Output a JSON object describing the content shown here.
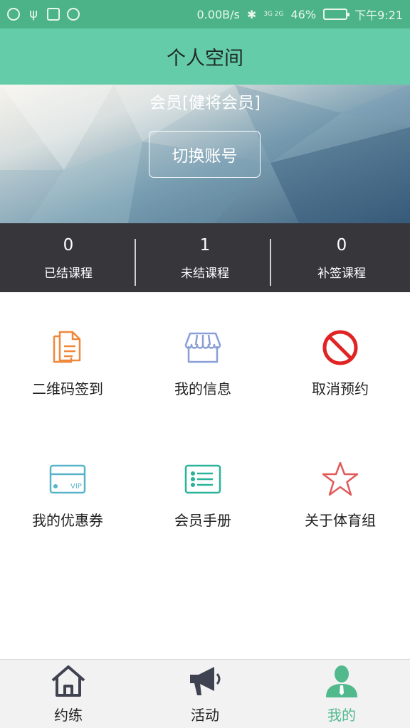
{
  "status_bar": {
    "speed": "0.00B/s",
    "signal": "3G 2G",
    "battery": "46%",
    "time": "下午9:21"
  },
  "title": "个人空间",
  "hero": {
    "member_label": "会员[健将会员]",
    "switch_button": "切换账号"
  },
  "stats": [
    {
      "value": "0",
      "label": "已结课程"
    },
    {
      "value": "1",
      "label": "未结课程"
    },
    {
      "value": "0",
      "label": "补签课程"
    }
  ],
  "menu": [
    {
      "label": "二维码签到",
      "icon": "documents-icon",
      "color": "#f0883c"
    },
    {
      "label": "我的信息",
      "icon": "store-icon",
      "color": "#8a9fd6"
    },
    {
      "label": "取消预约",
      "icon": "prohibited-icon",
      "color": "#e02424"
    },
    {
      "label": "我的优惠券",
      "icon": "vip-card-icon",
      "color": "#58b4c8"
    },
    {
      "label": "会员手册",
      "icon": "list-icon",
      "color": "#2ab39a"
    },
    {
      "label": "关于体育组",
      "icon": "star-icon",
      "color": "#e05a5a"
    }
  ],
  "bottom_nav": [
    {
      "label": "约练",
      "icon": "home-icon",
      "active": false
    },
    {
      "label": "活动",
      "icon": "megaphone-icon",
      "active": false
    },
    {
      "label": "我的",
      "icon": "profile-icon",
      "active": true
    }
  ],
  "colors": {
    "header": "#64cca8",
    "status_bar": "#4bb387",
    "stats_bar": "#37363b",
    "active_tab": "#52b98d"
  }
}
